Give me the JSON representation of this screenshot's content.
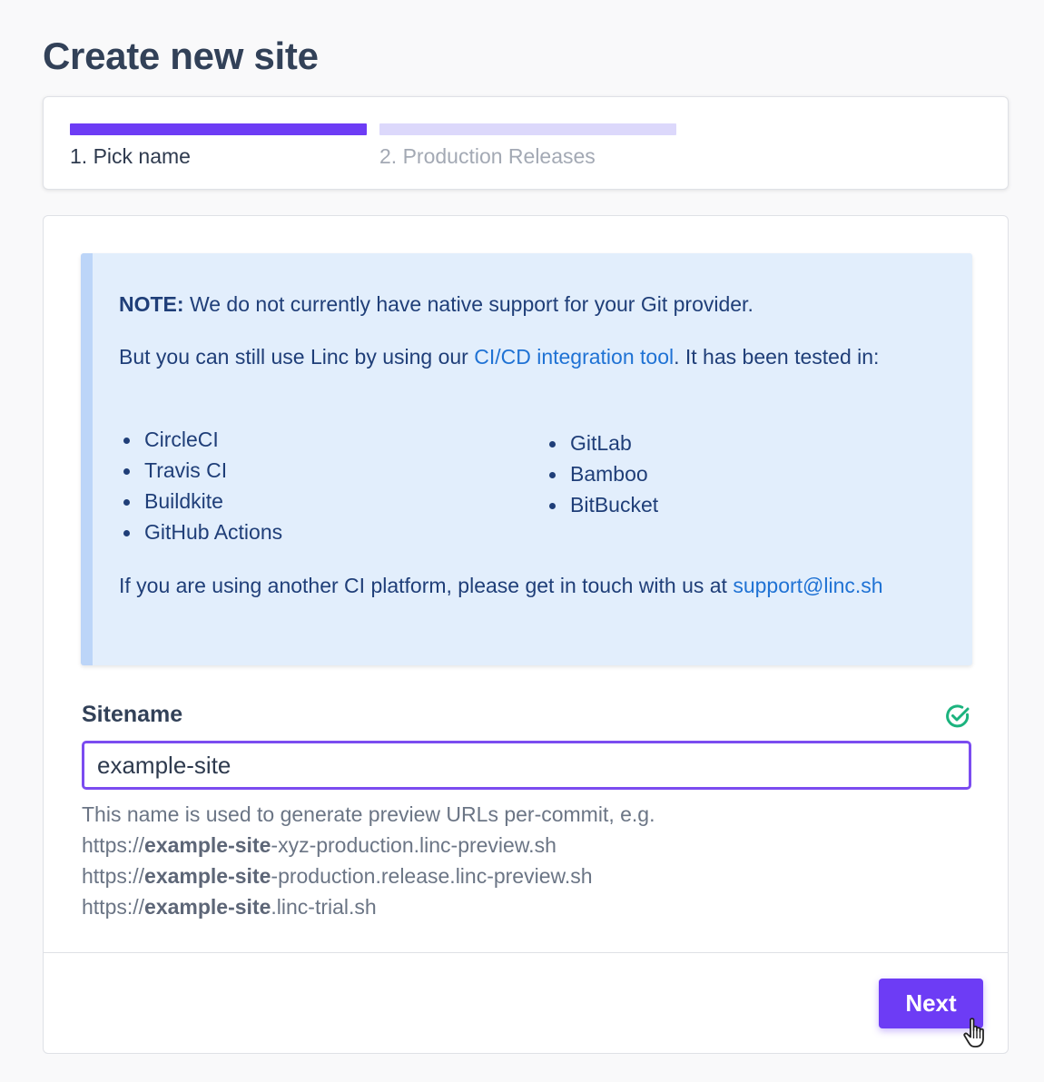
{
  "page": {
    "title": "Create new site"
  },
  "stepper": {
    "steps": [
      {
        "label": "1. Pick name",
        "state": "active"
      },
      {
        "label": "2. Production Releases",
        "state": "inactive"
      }
    ]
  },
  "note": {
    "heading_bold": "NOTE:",
    "heading_text": " We do not currently have native support for your Git provider.",
    "body_pre": "But you can still use Linc by using our ",
    "body_link": "CI/CD integration tool",
    "body_post": ". It has been tested in:",
    "ci_left": [
      "CircleCI",
      "Travis CI",
      "Buildkite",
      "GitHub Actions"
    ],
    "ci_right": [
      "GitLab",
      "Bamboo",
      "BitBucket"
    ],
    "footer_text": "If you are using another CI platform, please get in touch with us at ",
    "footer_email": "support@linc.sh"
  },
  "sitename": {
    "label": "Sitename",
    "value": "example-site",
    "valid": true,
    "help_intro": "This name is used to generate preview URLs per-commit, e.g.",
    "examples": [
      {
        "prefix": "https://",
        "name": "example-site",
        "suffix": "-xyz-production.linc-preview.sh"
      },
      {
        "prefix": "https://",
        "name": "example-site",
        "suffix": "-production.release.linc-preview.sh"
      },
      {
        "prefix": "https://",
        "name": "example-site",
        "suffix": ".linc-trial.sh"
      }
    ]
  },
  "actions": {
    "next_label": "Next"
  },
  "colors": {
    "accent": "#6d3cf5",
    "accent_light": "#dcd8fb",
    "note_bg": "#e2eefc",
    "note_border": "#bcd5f8",
    "link": "#1f72d4",
    "success": "#1bb37e"
  },
  "icons": {
    "valid": "check-circle-icon",
    "cursor": "hand-pointer-icon"
  }
}
